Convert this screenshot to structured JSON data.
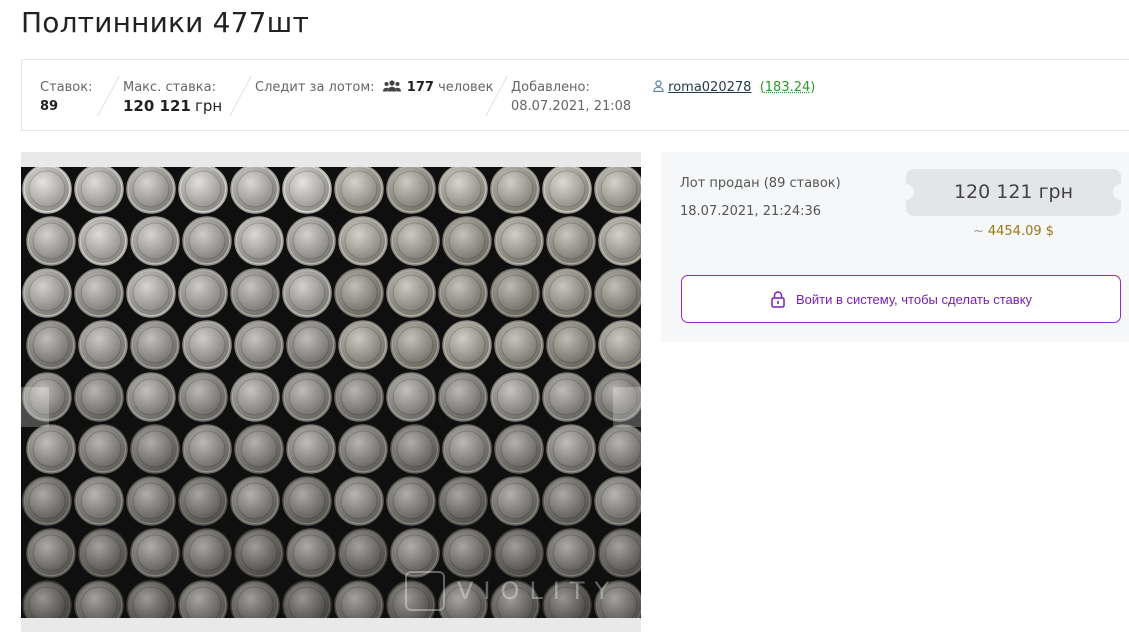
{
  "lot": {
    "title": "Полтинники 477шт"
  },
  "info": {
    "bids_label": "Ставок:",
    "bids_value": "89",
    "max_bid_label": "Макс. ставка:",
    "max_bid_value": "120 121",
    "max_bid_currency": "грн",
    "watching_label": "Следит за лотом:",
    "watching_count": "177",
    "watching_suffix": "человек",
    "added_label": "Добавлено:",
    "added_value": "08.07.2021, 21:08",
    "seller_name": "roma020278",
    "seller_rating": "183.24"
  },
  "gallery": {
    "watermark_text": "VIOLITY"
  },
  "sale": {
    "status": "Лот продан (89 ставок)",
    "date": "18.07.2021, 21:24:36",
    "price": "120 121 грн",
    "usd_tilde": "~",
    "usd": "4454.09 $",
    "login_button": "Войти в систему, чтобы сделать ставку"
  },
  "colors": {
    "accent": "#8e2bc9",
    "rating": "#2a9a2a",
    "usd": "#9a7a14"
  }
}
